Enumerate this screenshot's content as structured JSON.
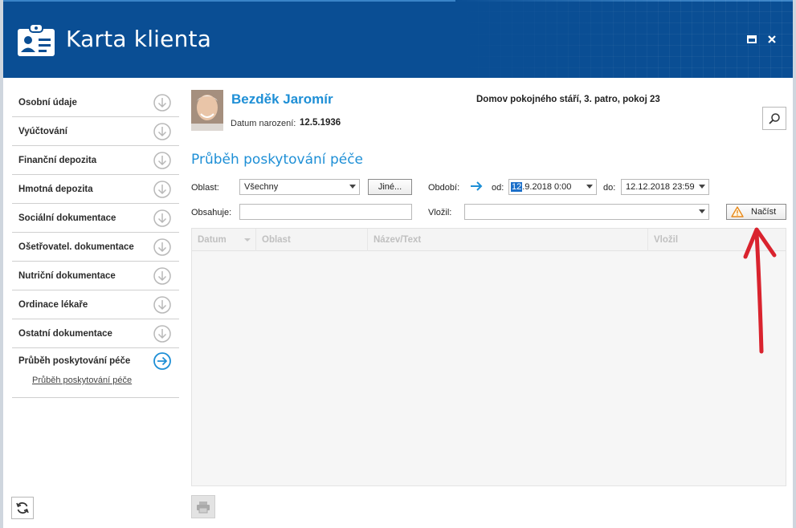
{
  "window": {
    "title": "Karta klienta",
    "icons": {
      "app": "id-card-icon",
      "maximize": "maximize-icon",
      "close": "close-icon"
    }
  },
  "sidebar": {
    "items": [
      {
        "label": "Osobní údaje"
      },
      {
        "label": "Vyúčtování"
      },
      {
        "label": "Finanční depozita"
      },
      {
        "label": "Hmotná depozita"
      },
      {
        "label": "Sociální dokumentace"
      },
      {
        "label": "Ošetřovatel. dokumentace"
      },
      {
        "label": "Nutriční dokumentace"
      },
      {
        "label": "Ordinace lékaře"
      },
      {
        "label": "Ostatní dokumentace"
      },
      {
        "label": "Průběh poskytování péče",
        "active": true
      }
    ],
    "subitem": "Průběh poskytování péče"
  },
  "client": {
    "name": "Bezděk Jaromír",
    "dob_label": "Datum narození:",
    "dob": "12.5.1936",
    "location": "Domov pokojného stáří, 3. patro, pokoj 23"
  },
  "section": {
    "title": "Průběh poskytování péče"
  },
  "filters": {
    "oblast_label": "Oblast:",
    "oblast_value": "Všechny",
    "jine_button": "Jiné...",
    "obdobi_label": "Období:",
    "od_label": "od:",
    "od_selected": "12",
    "od_rest": ".9.2018 0:00",
    "do_label": "do:",
    "do_value": "12.12.2018 23:59",
    "obsahuje_label": "Obsahuje:",
    "obsahuje_value": "",
    "vlozil_label": "Vložil:",
    "vlozil_value": "",
    "nacist_button": "Načíst"
  },
  "grid": {
    "columns": [
      "Datum",
      "Oblast",
      "Název/Text",
      "Vložil"
    ],
    "rows": []
  },
  "colors": {
    "header_bg": "#0a4e94",
    "accent": "#1e8fd6",
    "annotation_arrow": "#d9232e"
  }
}
